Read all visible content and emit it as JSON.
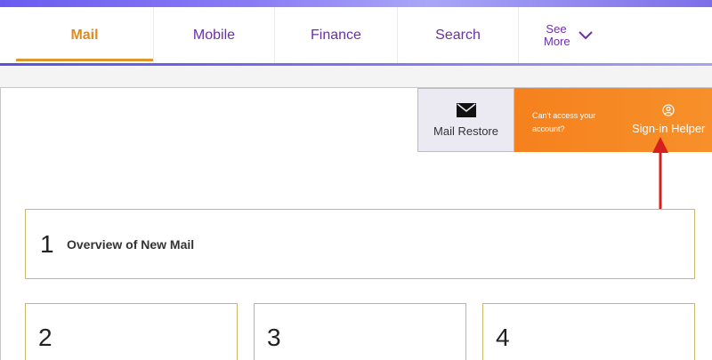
{
  "nav": {
    "tabs": [
      {
        "label": "Mail",
        "active": true
      },
      {
        "label": "Mobile",
        "active": false
      },
      {
        "label": "Finance",
        "active": false
      },
      {
        "label": "Search",
        "active": false
      }
    ],
    "more_label_line1": "See",
    "more_label_line2": "More"
  },
  "actions": {
    "mail_restore_label": "Mail Restore",
    "helper_question_line1": "Can't access your",
    "helper_question_line2": "account?",
    "helper_label": "Sign-in Helper"
  },
  "cards": [
    {
      "number": "1",
      "title": "Overview of New Mail"
    },
    {
      "number": "2"
    },
    {
      "number": "3"
    },
    {
      "number": "4"
    }
  ],
  "colors": {
    "accent_active_tab": "#e08a1c",
    "nav_text": "#6b2fa8",
    "helper_background": "#f5811d",
    "card_border": "#c9b86a",
    "annotation_arrow": "#d62020"
  },
  "icons": {
    "restore": "envelope-icon",
    "helper": "user-circle-icon",
    "more": "chevron-down-icon"
  }
}
